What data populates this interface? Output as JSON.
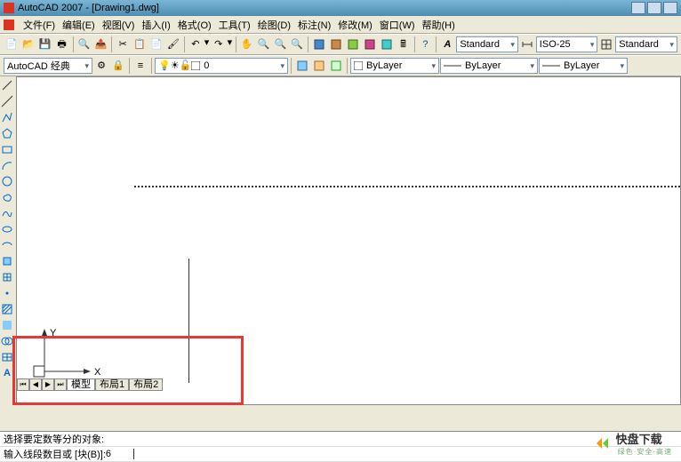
{
  "title": "AutoCAD 2007 - [Drawing1.dwg]",
  "menus": {
    "file": "文件(F)",
    "edit": "编辑(E)",
    "view": "视图(V)",
    "insert": "插入(I)",
    "format": "格式(O)",
    "tools": "工具(T)",
    "draw": "绘图(D)",
    "dimension": "标注(N)",
    "modify": "修改(M)",
    "window": "窗口(W)",
    "help": "帮助(H)"
  },
  "workspace": "AutoCAD 经典",
  "text_style": "Standard",
  "dim_style": "ISO-25",
  "table_style": "Standard",
  "layer_state": "0",
  "tb3": {
    "color": "ByLayer",
    "linetype": "ByLayer",
    "lineweight": "ByLayer"
  },
  "ucs": {
    "x": "X",
    "y": "Y"
  },
  "tabs": {
    "model": "模型",
    "layout1": "布局1",
    "layout2": "布局2"
  },
  "cmd": {
    "line1": "选择要定数等分的对象:",
    "line2_label": "输入线段数目或 [块(B)]: ",
    "line2_value": "6"
  },
  "watermark": {
    "name": "快盘下载",
    "sub": "绿色·安全·高速"
  },
  "colors": {
    "titlebar_start": "#7ab5d6",
    "titlebar_end": "#4e8db0",
    "frame_bg": "#ece9d8",
    "highlight": "#e53935"
  }
}
